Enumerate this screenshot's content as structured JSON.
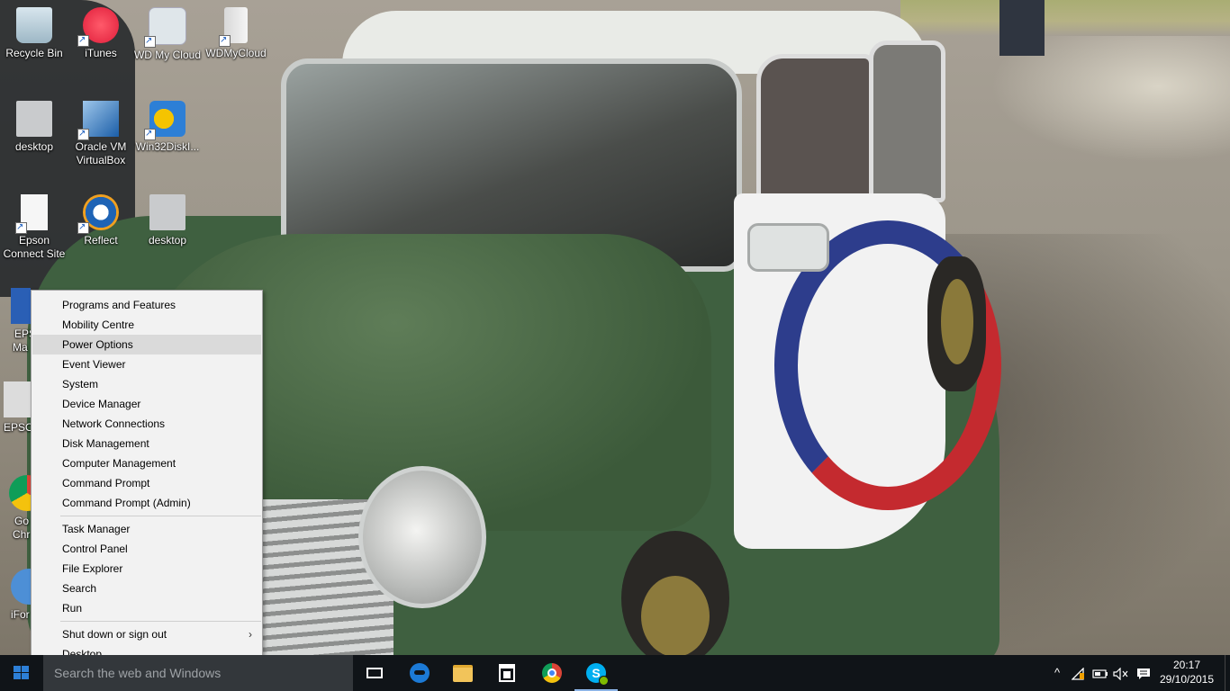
{
  "desktop": {
    "icons": [
      {
        "label": "Recycle Bin",
        "icon": "recycle-bin-icon"
      },
      {
        "label": "iTunes",
        "icon": "itunes-icon"
      },
      {
        "label": "WD My Cloud",
        "icon": "wd-my-cloud-icon"
      },
      {
        "label": "WDMyCloud",
        "icon": "drive-icon"
      },
      {
        "label": "desktop",
        "icon": "settings-file-icon"
      },
      {
        "label": "Oracle VM VirtualBox",
        "icon": "virtualbox-icon"
      },
      {
        "label": "Win32DiskI...",
        "icon": "win32-disk-imager-icon"
      },
      {
        "label": "Epson Connect Site",
        "icon": "file-icon"
      },
      {
        "label": "Reflect",
        "icon": "reflect-icon"
      },
      {
        "label": "desktop",
        "icon": "settings-file-icon"
      },
      {
        "label": "EPS",
        "icon": "epson-icon"
      },
      {
        "label": "Ma",
        "icon": "epson-icon"
      },
      {
        "label": "EPSO",
        "icon": "epson-icon"
      },
      {
        "label": "Go",
        "icon": "chrome-icon"
      },
      {
        "label": "Chr",
        "icon": "chrome-icon"
      },
      {
        "label": "iFor",
        "icon": "app-icon"
      }
    ]
  },
  "context_menu": {
    "items": [
      "Programs and Features",
      "Mobility Centre",
      "Power Options",
      "Event Viewer",
      "System",
      "Device Manager",
      "Network Connections",
      "Disk Management",
      "Computer Management",
      "Command Prompt",
      "Command Prompt (Admin)",
      "Task Manager",
      "Control Panel",
      "File Explorer",
      "Search",
      "Run",
      "Shut down or sign out",
      "Desktop"
    ],
    "highlighted": "Power Options",
    "submenu_arrow": "›"
  },
  "taskbar": {
    "search_placeholder": "Search the web and Windows",
    "pinned": [
      {
        "name": "task-view",
        "icon": "task-view-icon"
      },
      {
        "name": "edge",
        "icon": "edge-icon"
      },
      {
        "name": "file-explorer",
        "icon": "folder-icon"
      },
      {
        "name": "store",
        "icon": "store-icon"
      },
      {
        "name": "chrome",
        "icon": "chrome-icon"
      },
      {
        "name": "skype",
        "icon": "skype-icon",
        "active": true
      }
    ],
    "tray": {
      "chevron": "^",
      "time": "20:17",
      "date": "29/10/2015"
    }
  },
  "colors": {
    "taskbar_bg": "#101418",
    "accent": "#2d7fd6",
    "menu_bg": "#f2f2f2",
    "menu_highlight": "#dadada"
  }
}
